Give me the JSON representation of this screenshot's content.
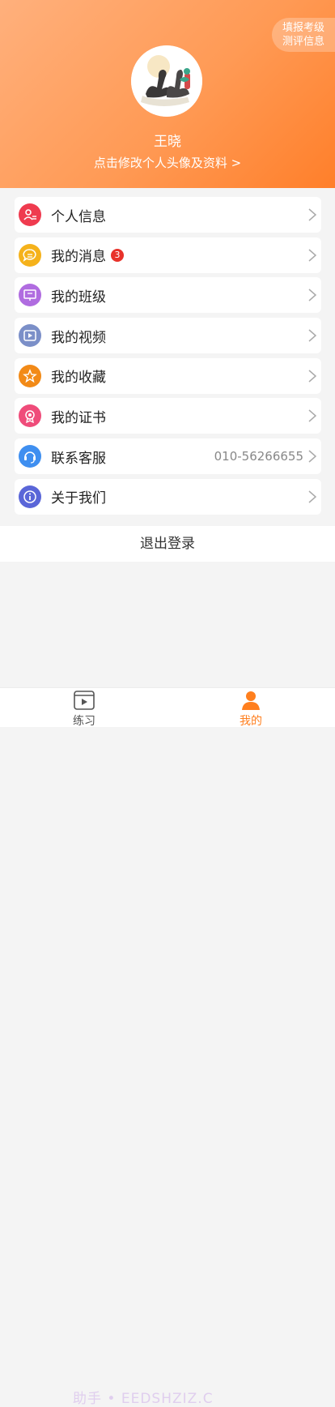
{
  "header": {
    "fill_button": "填报考级测评信息",
    "user_name": "王晓",
    "edit_profile": "点击修改个人头像及资料 >"
  },
  "menu": [
    {
      "label": "个人信息",
      "icon": "person-card-icon",
      "color": "#ef3b4f"
    },
    {
      "label": "我的消息",
      "icon": "chat-bubble-icon",
      "color": "#f5b21b",
      "badge": "3"
    },
    {
      "label": "我的班级",
      "icon": "classroom-board-icon",
      "color": "#b06ce0"
    },
    {
      "label": "我的视频",
      "icon": "video-icon",
      "color": "#7b8fc8"
    },
    {
      "label": "我的收藏",
      "icon": "star-icon",
      "color": "#f28a17"
    },
    {
      "label": "我的证书",
      "icon": "certificate-icon",
      "color": "#ef4c7a"
    },
    {
      "label": "联系客服",
      "icon": "headset-icon",
      "color": "#3f8ff0",
      "value": "010-56266655"
    },
    {
      "label": "关于我们",
      "icon": "info-icon",
      "color": "#5a66d8"
    }
  ],
  "logout": "退出登录",
  "tabs": [
    {
      "label": "练习",
      "icon": "practice-video-icon",
      "color": "#555555"
    },
    {
      "label": "我的",
      "icon": "profile-icon",
      "color": "#ff7f1e"
    }
  ],
  "watermark": "助手 • EEDSHZIZ.C"
}
